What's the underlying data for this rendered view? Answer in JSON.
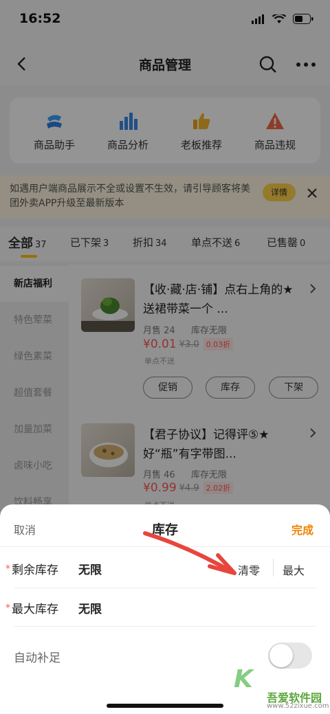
{
  "status_bar": {
    "time": "16:52"
  },
  "header": {
    "title": "商品管理"
  },
  "tools": [
    {
      "label": "商品助手",
      "icon": "robot-icon"
    },
    {
      "label": "商品分析",
      "icon": "bar-chart-icon"
    },
    {
      "label": "老板推荐",
      "icon": "thumbs-up-icon"
    },
    {
      "label": "商品违规",
      "icon": "warning-icon"
    }
  ],
  "notice": {
    "text": "如遇用户端商品展示不全或设置不生效，请引导顾客将美团外卖APP升级至最新版本",
    "button": "详情"
  },
  "tabs": [
    {
      "label": "全部",
      "count": "37"
    },
    {
      "label": "已下架",
      "count": "3"
    },
    {
      "label": "折扣",
      "count": "34"
    },
    {
      "label": "单点不送",
      "count": "6"
    },
    {
      "label": "已售罄",
      "count": "0"
    }
  ],
  "categories": [
    "新店福利",
    "特色荤菜",
    "绿色素菜",
    "超值套餐",
    "加量加菜",
    "卤味小吃",
    "饮料畅享"
  ],
  "products": [
    {
      "title": "【收·藏·店·铺】点右上角的★送裙带菜一个 ...",
      "sold": "月售 24",
      "stock": "库存无限",
      "price": "¥0.01",
      "original": "¥3.0",
      "discount": "0.03折",
      "tag": "单点不送",
      "buttons": [
        "促销",
        "库存",
        "下架"
      ]
    },
    {
      "title": "【君子协议】记得评⑤★好“瓶”有字带图...",
      "sold": "月售 46",
      "stock": "库存无限",
      "price": "¥0.99",
      "original": "¥4.9",
      "discount": "2.02折",
      "tag": "单点不送"
    }
  ],
  "sheet": {
    "cancel": "取消",
    "title": "库存",
    "done": "完成",
    "remaining_label": "剩余库存",
    "remaining_value": "无限",
    "clear_button": "清零",
    "max_button": "最大",
    "max_label": "最大库存",
    "max_value": "无限",
    "auto_label": "自动补足",
    "auto_enabled": false
  },
  "watermark": {
    "name": "吾爱软件园",
    "url": "www.52zixue.com"
  },
  "colors": {
    "accent": "#ffc300",
    "price": "#ff5555",
    "done": "#f08300"
  }
}
